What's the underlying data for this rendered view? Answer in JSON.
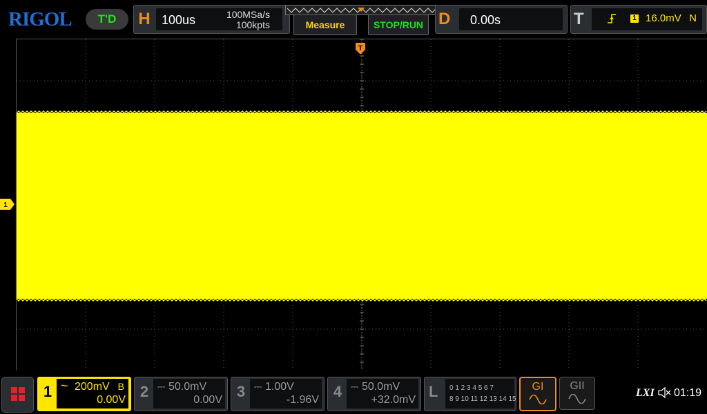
{
  "header": {
    "logo": "RIGOL",
    "status_badge": "T'D",
    "horizontal": {
      "letter": "H",
      "timebase": "100us",
      "sample_rate": "100MSa/s",
      "memory_depth": "100kpts"
    },
    "buttons": {
      "measure": "Measure",
      "stop_run": "STOP/RUN"
    },
    "delay": {
      "letter": "D",
      "value": "0.00s"
    },
    "trigger": {
      "letter": "T",
      "source": "1",
      "level": "16.0mV",
      "mode": "N"
    }
  },
  "screen": {
    "trigger_position_marker": "T",
    "channel_marker": "1",
    "colors": {
      "ch1": "#ffff00",
      "grid": "#5a5a5a",
      "accent": "#f08c1e"
    }
  },
  "channels": [
    {
      "num": "1",
      "coupling": "~",
      "scale": "200mV",
      "bw_limit": "B",
      "offset": "0.00V"
    },
    {
      "num": "2",
      "coupling": "⎓",
      "scale": "50.0mV",
      "offset": "0.00V"
    },
    {
      "num": "3",
      "coupling": "⎓",
      "scale": "1.00V",
      "offset": "-1.96V"
    },
    {
      "num": "4",
      "coupling": "⎓",
      "scale": "50.0mV",
      "offset": "+32.0mV"
    }
  ],
  "logic": {
    "letter": "L",
    "row1": "0 1 2 3   4 5 6 7",
    "row2": "8 9 10 11  12 13 14 15"
  },
  "generators": [
    {
      "label": "GI"
    },
    {
      "label": "GII"
    }
  ],
  "status": {
    "lxi": "LXI",
    "speaker_icon": "speaker-muted-icon",
    "time": "01:19"
  }
}
